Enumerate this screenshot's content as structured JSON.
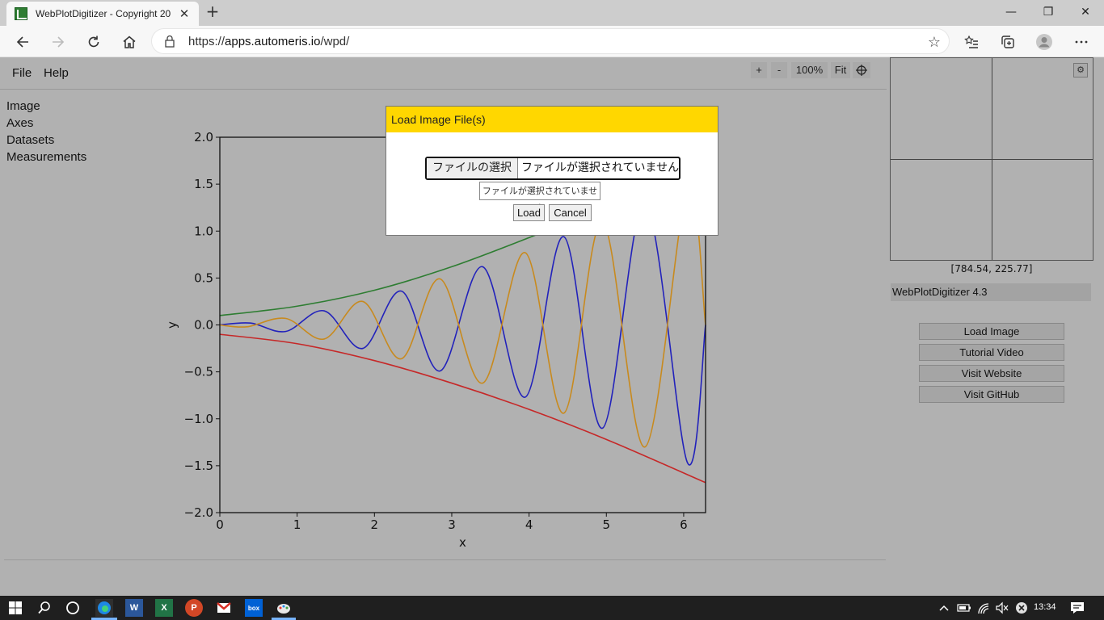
{
  "browser": {
    "tab_title": "WebPlotDigitizer - Copyright 20",
    "url_prefix": "https://",
    "url_host": "apps.automeris.io",
    "url_path": "/wpd/"
  },
  "app": {
    "menu": [
      "File",
      "Help"
    ],
    "zoom": {
      "plus": "+",
      "minus": "-",
      "level": "100%",
      "fit": "Fit"
    },
    "sidebar": [
      "Image",
      "Axes",
      "Datasets",
      "Measurements"
    ],
    "coords": "[784.54, 225.77]",
    "version": "WebPlotDigitizer 4.3",
    "buttons": [
      "Load Image",
      "Tutorial Video",
      "Visit Website",
      "Visit GitHub"
    ]
  },
  "modal": {
    "title": "Load Image File(s)",
    "file_button": "ファイルの選択",
    "file_status": "ファイルが選択されていません",
    "tooltip": "ファイルが選択されていません",
    "load": "Load",
    "cancel": "Cancel"
  },
  "taskbar": {
    "time": "13:34"
  },
  "chart_data": {
    "type": "line",
    "xlabel": "x",
    "ylabel": "y",
    "xlim": [
      0,
      6.283
    ],
    "ylim": [
      -2.0,
      2.0
    ],
    "xticks": [
      "0",
      "1",
      "2",
      "3",
      "4",
      "5",
      "6"
    ],
    "yticks": [
      "2.0",
      "1.5",
      "1.0",
      "0.5",
      "0.0",
      "−0.5",
      "−1.0",
      "−1.5",
      "−2.0"
    ],
    "series": [
      {
        "color": "#2e7d32",
        "x": [
          0,
          1,
          2,
          3,
          4,
          4.2
        ],
        "y": [
          0.1,
          0.2,
          0.37,
          0.62,
          0.93,
          1.0
        ]
      },
      {
        "color": "#c62828",
        "x": [
          0,
          1,
          2,
          3,
          4,
          5,
          6.283
        ],
        "y": [
          -0.1,
          -0.2,
          -0.38,
          -0.62,
          -0.9,
          -1.22,
          -1.68
        ]
      },
      {
        "color": "#2222bb",
        "x": [
          0,
          0.4,
          0.85,
          1.35,
          1.85,
          2.35,
          2.85,
          3.4,
          3.95,
          4.45,
          4.95,
          5.5,
          6.05,
          6.283
        ],
        "y": [
          0,
          0.02,
          -0.07,
          0.15,
          -0.25,
          0.36,
          -0.49,
          0.62,
          -0.77,
          0.94,
          -1.1,
          1.3,
          -1.47,
          0
        ]
      },
      {
        "color": "#c88a1e",
        "x": [
          0,
          0.35,
          0.85,
          1.35,
          1.85,
          2.35,
          2.85,
          3.4,
          3.95,
          4.45,
          4.95,
          5.5,
          6.05,
          6.283
        ],
        "y": [
          0,
          -0.02,
          0.07,
          -0.15,
          0.25,
          -0.36,
          0.49,
          -0.62,
          0.77,
          -0.94,
          1.1,
          -1.3,
          1.47,
          0
        ]
      }
    ]
  }
}
